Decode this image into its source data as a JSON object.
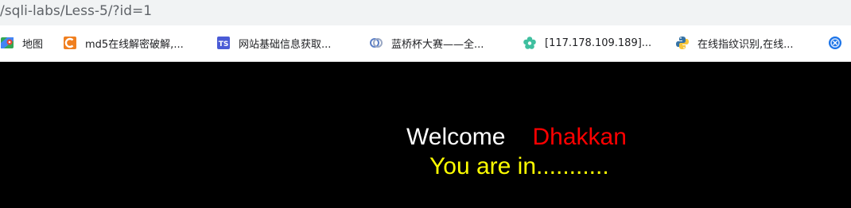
{
  "address_bar": {
    "url": "/sqli-labs/Less-5/?id=1"
  },
  "bookmarks": [
    {
      "label": "地图",
      "icon": "google-maps-icon",
      "color": "#34a853"
    },
    {
      "label": "md5在线解密破解,...",
      "icon": "cmd5-icon",
      "color": "#f07f1f"
    },
    {
      "label": "网站基础信息获取...",
      "icon": "ts-icon",
      "color": "#4a5bd6"
    },
    {
      "label": "蓝桥杯大赛——全...",
      "icon": "lanqiao-icon",
      "color": "#5b7fc7"
    },
    {
      "label": "[117.178.109.189]...",
      "icon": "flower-icon",
      "color": "#3fbf9f"
    },
    {
      "label": "在线指纹识别,在线...",
      "icon": "python-icon",
      "color": "#3572a5"
    },
    {
      "label": "",
      "icon": "blue-circle-icon",
      "color": "#1a73e8"
    }
  ],
  "page": {
    "welcome": "Welcome",
    "name": "Dhakkan",
    "status": "You are in..........."
  }
}
